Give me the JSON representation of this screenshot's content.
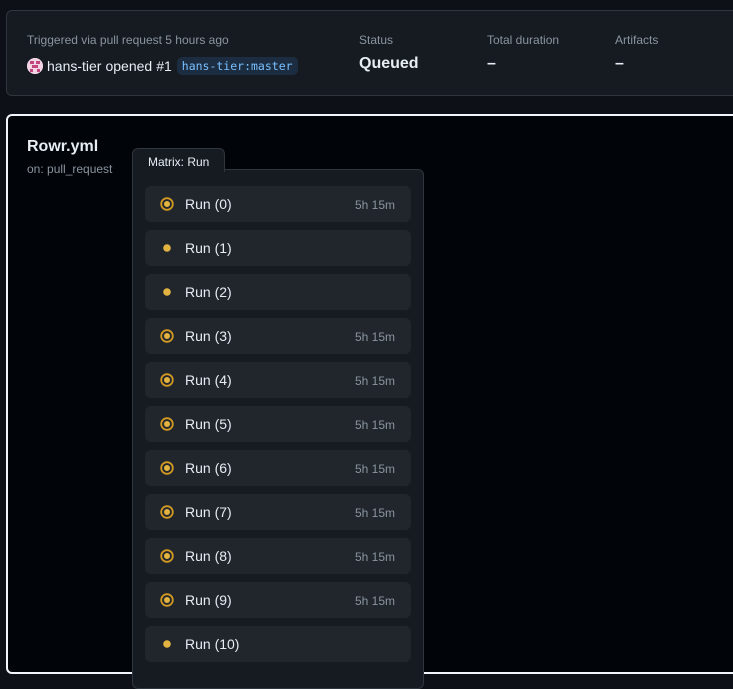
{
  "summary": {
    "trigger_text": "Triggered via pull request 5 hours ago",
    "actor_name": "hans-tier",
    "opened_text": "opened",
    "pr_number": "#1",
    "branch_label": "hans-tier:master",
    "status_label": "Status",
    "status_value": "Queued",
    "duration_label": "Total duration",
    "duration_value": "–",
    "artifacts_label": "Artifacts",
    "artifacts_value": "–"
  },
  "workflow": {
    "name": "Rowr.yml",
    "trigger": "on: pull_request",
    "matrix_label": "Matrix: Run",
    "jobs": [
      {
        "label": "Run (0)",
        "duration": "5h 15m",
        "status": "in-progress-icon"
      },
      {
        "label": "Run (1)",
        "duration": "",
        "status": "queued-dot-icon"
      },
      {
        "label": "Run (2)",
        "duration": "",
        "status": "queued-dot-icon"
      },
      {
        "label": "Run (3)",
        "duration": "5h 15m",
        "status": "in-progress-icon"
      },
      {
        "label": "Run (4)",
        "duration": "5h 15m",
        "status": "in-progress-icon"
      },
      {
        "label": "Run (5)",
        "duration": "5h 15m",
        "status": "in-progress-icon"
      },
      {
        "label": "Run (6)",
        "duration": "5h 15m",
        "status": "in-progress-icon"
      },
      {
        "label": "Run (7)",
        "duration": "5h 15m",
        "status": "in-progress-icon"
      },
      {
        "label": "Run (8)",
        "duration": "5h 15m",
        "status": "in-progress-icon"
      },
      {
        "label": "Run (9)",
        "duration": "5h 15m",
        "status": "in-progress-icon"
      },
      {
        "label": "Run (10)",
        "duration": "",
        "status": "queued-dot-icon"
      }
    ]
  },
  "colors": {
    "status_yellow": "#d29922",
    "dot_yellow": "#e3b341"
  }
}
